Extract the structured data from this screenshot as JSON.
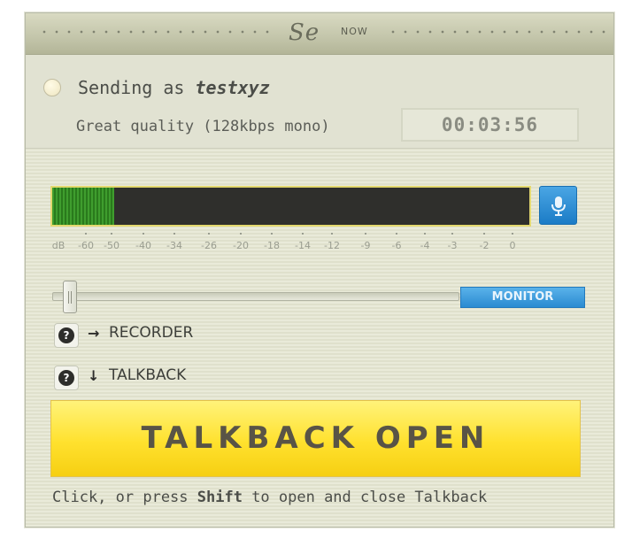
{
  "header": {
    "logo_text": "Se",
    "logo_suffix": "NOW"
  },
  "status": {
    "sending_prefix": "Sending as",
    "username": "testxyz",
    "quality": "Great quality (128kbps mono)",
    "timer": "00:03:56"
  },
  "meter": {
    "level_fraction": 0.13,
    "scale": [
      "dB",
      "-60",
      "-50",
      "-40",
      "-34",
      "-26",
      "-20",
      "-18",
      "-14",
      "-12",
      "-9",
      "-6",
      "-4",
      "-3",
      "-2",
      "0"
    ],
    "colors": {
      "level": "#3f9d2e",
      "border": "#e3d86e",
      "background": "#2f2f2c"
    }
  },
  "mic_button": {
    "icon": "microphone-icon"
  },
  "monitor": {
    "slider_fraction": 0.02,
    "button_label": "MONITOR"
  },
  "routes": [
    {
      "help_glyph": "?",
      "arrow": "→",
      "label": "RECORDER"
    },
    {
      "help_glyph": "?",
      "arrow": "↓",
      "label": "TALKBACK"
    }
  ],
  "talkback": {
    "button_label": "TALKBACK OPEN"
  },
  "hint": {
    "before": "Click, or press ",
    "key": "Shift",
    "after": " to open and close Talkback"
  },
  "colors": {
    "accent_blue": "#2a8bd1",
    "talkback_yellow": "#ffe12e"
  }
}
